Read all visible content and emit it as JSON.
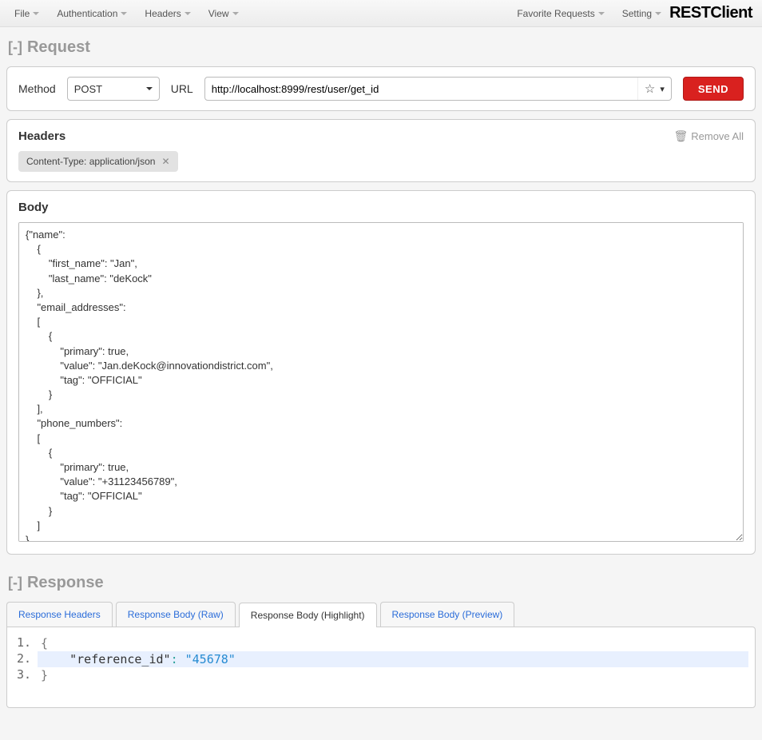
{
  "brand": "RESTClient",
  "menu_left": [
    "File",
    "Authentication",
    "Headers",
    "View"
  ],
  "menu_right": [
    "Favorite Requests",
    "Setting"
  ],
  "request": {
    "title": "Request",
    "method_label": "Method",
    "method_value": "POST",
    "url_label": "URL",
    "url_value": "http://localhost:8999/rest/user/get_id",
    "send_label": "SEND",
    "headers_title": "Headers",
    "remove_all_label": "Remove All",
    "header_chip": "Content-Type: application/json",
    "body_title": "Body",
    "body_content": "{\"name\":\n    {\n        \"first_name\": \"Jan\",\n        \"last_name\": \"deKock\"\n    },\n    \"email_addresses\":\n    [\n        {\n            \"primary\": true,\n            \"value\": \"Jan.deKock@innovationdistrict.com\",\n            \"tag\": \"OFFICIAL\"\n        }\n    ],\n    \"phone_numbers\":\n    [\n        {\n            \"primary\": true,\n            \"value\": \"+31123456789\",\n            \"tag\": \"OFFICIAL\"\n        }\n    ]\n}"
  },
  "response": {
    "title": "Response",
    "tabs": [
      "Response Headers",
      "Response Body (Raw)",
      "Response Body (Highlight)",
      "Response Body (Preview)"
    ],
    "active_tab": 2,
    "code": {
      "key": "\"reference_id\"",
      "value": "\"45678\""
    }
  }
}
